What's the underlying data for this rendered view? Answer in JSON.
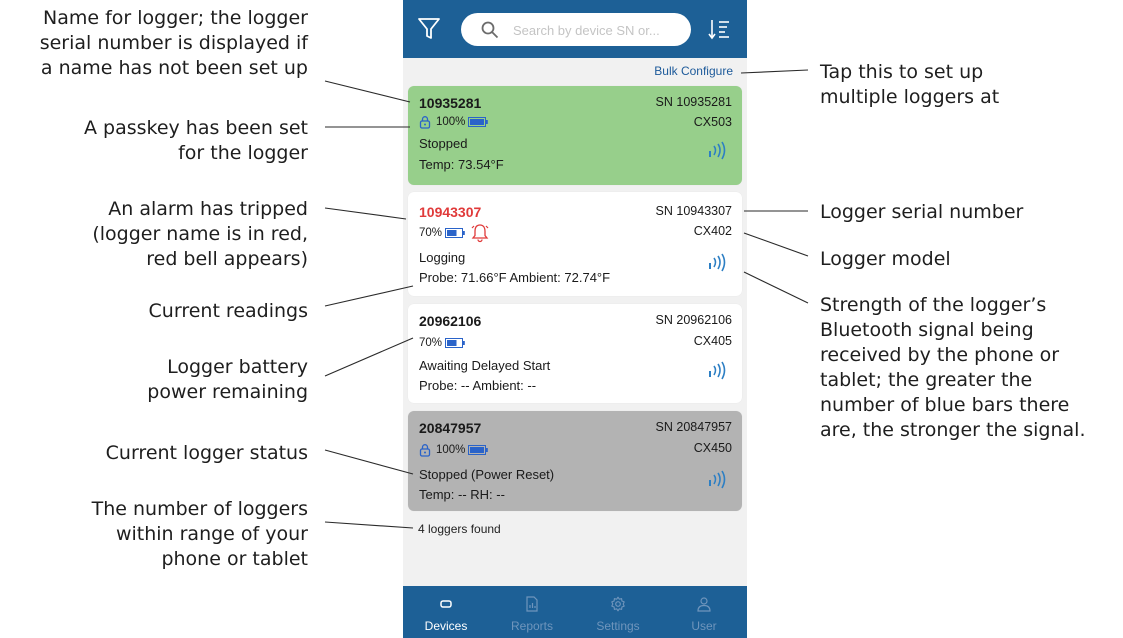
{
  "search": {
    "placeholder": "Search by device SN or..."
  },
  "header": {
    "bulk_configure_label": "Bulk Configure"
  },
  "loggers": [
    {
      "name": "10935281",
      "sn": "SN 10935281",
      "model": "CX503",
      "battery": "100%",
      "status": "Stopped",
      "readings": "Temp: 73.54°F",
      "card_color": "#97cf8b",
      "name_color": "#1a1a1a",
      "passkey": true,
      "alarm": false
    },
    {
      "name": "10943307",
      "sn": "SN 10943307",
      "model": "CX402",
      "battery": "70%",
      "status": "Logging",
      "readings": "Probe: 71.66°F Ambient: 72.74°F",
      "card_color": "#ffffff",
      "name_color": "#e03a3a",
      "passkey": false,
      "alarm": true
    },
    {
      "name": "20962106",
      "sn": "SN 20962106",
      "model": "CX405",
      "battery": "70%",
      "status": "Awaiting Delayed Start",
      "readings": "Probe: -- Ambient: --",
      "card_color": "#ffffff",
      "name_color": "#1a1a1a",
      "passkey": false,
      "alarm": false
    },
    {
      "name": "20847957",
      "sn": "SN 20847957",
      "model": "CX450",
      "battery": "100%",
      "status": "Stopped (Power Reset)",
      "readings": "Temp: -- RH: --",
      "card_color": "#b3b3b3",
      "name_color": "#1a1a1a",
      "passkey": true,
      "alarm": false
    }
  ],
  "footer": {
    "loggers_found": "4 loggers found"
  },
  "nav": [
    {
      "label": "Devices",
      "icon": "devices-icon",
      "active": true
    },
    {
      "label": "Reports",
      "icon": "reports-icon",
      "active": false
    },
    {
      "label": "Settings",
      "icon": "settings-icon",
      "active": false
    },
    {
      "label": "User",
      "icon": "user-icon",
      "active": false
    }
  ],
  "annotations": {
    "left": [
      [
        "Name for logger; the logger",
        "serial number is displayed if",
        "a name has not been set up"
      ],
      [
        "A passkey has been set",
        "for the logger"
      ],
      [
        "An alarm has tripped",
        "(logger name is in red,",
        "red bell appears)"
      ],
      [
        "Current readings"
      ],
      [
        "Logger battery",
        "power remaining"
      ],
      [
        "Current logger status"
      ],
      [
        "The number of loggers",
        "within range of your",
        "phone or tablet"
      ]
    ],
    "right": [
      [
        "Tap this to set up",
        "multiple loggers at"
      ],
      [
        "Logger serial number"
      ],
      [
        "Logger model"
      ],
      [
        "Strength of the logger’s",
        "Bluetooth signal being",
        "received by the phone or",
        "tablet; the greater the",
        "number of blue bars there",
        "are, the stronger the signal."
      ]
    ]
  },
  "colors": {
    "brand_blue": "#1d6096",
    "link_blue": "#1d5a9a",
    "signal_blue": "#2d7fc4",
    "alarm_red": "#e03a3a",
    "battery_blue": "#2a63c9"
  }
}
